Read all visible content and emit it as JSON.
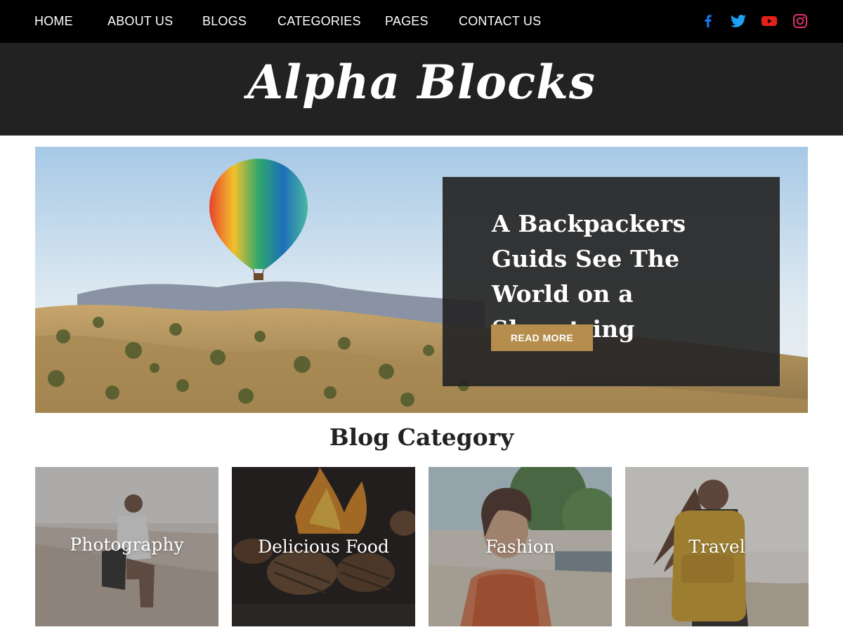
{
  "nav": {
    "items": [
      {
        "label": "HOME"
      },
      {
        "label": "ABOUT US"
      },
      {
        "label": "BLOGS"
      },
      {
        "label": "CATEGORIES"
      },
      {
        "label": "PAGES"
      },
      {
        "label": "CONTACT US"
      }
    ],
    "social": [
      {
        "icon": "facebook-icon",
        "color": "#1877f2"
      },
      {
        "icon": "twitter-icon",
        "color": "#1da1f2"
      },
      {
        "icon": "youtube-icon",
        "color": "#e62117"
      },
      {
        "icon": "instagram-icon",
        "color": "#e1306c"
      }
    ]
  },
  "header": {
    "logo_text": "Alpha Blocks"
  },
  "hero": {
    "title": "A Backpackers Guids See The World on  a Shoestring",
    "button_label": "READ MORE",
    "button_color": "#b68d4c"
  },
  "blog_category": {
    "title": "Blog Category",
    "cards": [
      {
        "label": "Photography"
      },
      {
        "label": "Delicious Food"
      },
      {
        "label": "Fashion"
      },
      {
        "label": "Travel"
      }
    ]
  }
}
